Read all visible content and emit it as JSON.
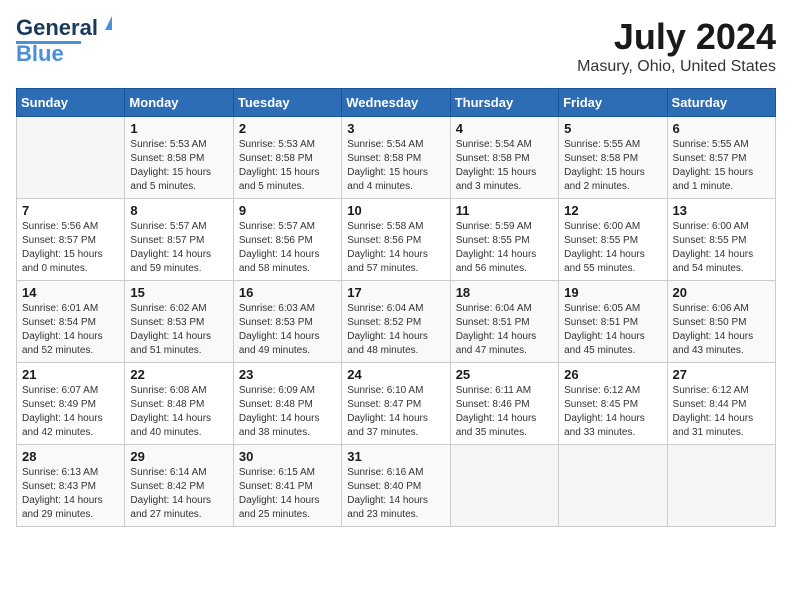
{
  "logo": {
    "text_general": "General",
    "text_blue": "Blue"
  },
  "header": {
    "month_year": "July 2024",
    "location": "Masury, Ohio, United States"
  },
  "weekdays": [
    "Sunday",
    "Monday",
    "Tuesday",
    "Wednesday",
    "Thursday",
    "Friday",
    "Saturday"
  ],
  "weeks": [
    [
      {
        "day": "",
        "sunrise": "",
        "sunset": "",
        "daylight": ""
      },
      {
        "day": "1",
        "sunrise": "Sunrise: 5:53 AM",
        "sunset": "Sunset: 8:58 PM",
        "daylight": "Daylight: 15 hours and 5 minutes."
      },
      {
        "day": "2",
        "sunrise": "Sunrise: 5:53 AM",
        "sunset": "Sunset: 8:58 PM",
        "daylight": "Daylight: 15 hours and 5 minutes."
      },
      {
        "day": "3",
        "sunrise": "Sunrise: 5:54 AM",
        "sunset": "Sunset: 8:58 PM",
        "daylight": "Daylight: 15 hours and 4 minutes."
      },
      {
        "day": "4",
        "sunrise": "Sunrise: 5:54 AM",
        "sunset": "Sunset: 8:58 PM",
        "daylight": "Daylight: 15 hours and 3 minutes."
      },
      {
        "day": "5",
        "sunrise": "Sunrise: 5:55 AM",
        "sunset": "Sunset: 8:58 PM",
        "daylight": "Daylight: 15 hours and 2 minutes."
      },
      {
        "day": "6",
        "sunrise": "Sunrise: 5:55 AM",
        "sunset": "Sunset: 8:57 PM",
        "daylight": "Daylight: 15 hours and 1 minute."
      }
    ],
    [
      {
        "day": "7",
        "sunrise": "Sunrise: 5:56 AM",
        "sunset": "Sunset: 8:57 PM",
        "daylight": "Daylight: 15 hours and 0 minutes."
      },
      {
        "day": "8",
        "sunrise": "Sunrise: 5:57 AM",
        "sunset": "Sunset: 8:57 PM",
        "daylight": "Daylight: 14 hours and 59 minutes."
      },
      {
        "day": "9",
        "sunrise": "Sunrise: 5:57 AM",
        "sunset": "Sunset: 8:56 PM",
        "daylight": "Daylight: 14 hours and 58 minutes."
      },
      {
        "day": "10",
        "sunrise": "Sunrise: 5:58 AM",
        "sunset": "Sunset: 8:56 PM",
        "daylight": "Daylight: 14 hours and 57 minutes."
      },
      {
        "day": "11",
        "sunrise": "Sunrise: 5:59 AM",
        "sunset": "Sunset: 8:55 PM",
        "daylight": "Daylight: 14 hours and 56 minutes."
      },
      {
        "day": "12",
        "sunrise": "Sunrise: 6:00 AM",
        "sunset": "Sunset: 8:55 PM",
        "daylight": "Daylight: 14 hours and 55 minutes."
      },
      {
        "day": "13",
        "sunrise": "Sunrise: 6:00 AM",
        "sunset": "Sunset: 8:55 PM",
        "daylight": "Daylight: 14 hours and 54 minutes."
      }
    ],
    [
      {
        "day": "14",
        "sunrise": "Sunrise: 6:01 AM",
        "sunset": "Sunset: 8:54 PM",
        "daylight": "Daylight: 14 hours and 52 minutes."
      },
      {
        "day": "15",
        "sunrise": "Sunrise: 6:02 AM",
        "sunset": "Sunset: 8:53 PM",
        "daylight": "Daylight: 14 hours and 51 minutes."
      },
      {
        "day": "16",
        "sunrise": "Sunrise: 6:03 AM",
        "sunset": "Sunset: 8:53 PM",
        "daylight": "Daylight: 14 hours and 49 minutes."
      },
      {
        "day": "17",
        "sunrise": "Sunrise: 6:04 AM",
        "sunset": "Sunset: 8:52 PM",
        "daylight": "Daylight: 14 hours and 48 minutes."
      },
      {
        "day": "18",
        "sunrise": "Sunrise: 6:04 AM",
        "sunset": "Sunset: 8:51 PM",
        "daylight": "Daylight: 14 hours and 47 minutes."
      },
      {
        "day": "19",
        "sunrise": "Sunrise: 6:05 AM",
        "sunset": "Sunset: 8:51 PM",
        "daylight": "Daylight: 14 hours and 45 minutes."
      },
      {
        "day": "20",
        "sunrise": "Sunrise: 6:06 AM",
        "sunset": "Sunset: 8:50 PM",
        "daylight": "Daylight: 14 hours and 43 minutes."
      }
    ],
    [
      {
        "day": "21",
        "sunrise": "Sunrise: 6:07 AM",
        "sunset": "Sunset: 8:49 PM",
        "daylight": "Daylight: 14 hours and 42 minutes."
      },
      {
        "day": "22",
        "sunrise": "Sunrise: 6:08 AM",
        "sunset": "Sunset: 8:48 PM",
        "daylight": "Daylight: 14 hours and 40 minutes."
      },
      {
        "day": "23",
        "sunrise": "Sunrise: 6:09 AM",
        "sunset": "Sunset: 8:48 PM",
        "daylight": "Daylight: 14 hours and 38 minutes."
      },
      {
        "day": "24",
        "sunrise": "Sunrise: 6:10 AM",
        "sunset": "Sunset: 8:47 PM",
        "daylight": "Daylight: 14 hours and 37 minutes."
      },
      {
        "day": "25",
        "sunrise": "Sunrise: 6:11 AM",
        "sunset": "Sunset: 8:46 PM",
        "daylight": "Daylight: 14 hours and 35 minutes."
      },
      {
        "day": "26",
        "sunrise": "Sunrise: 6:12 AM",
        "sunset": "Sunset: 8:45 PM",
        "daylight": "Daylight: 14 hours and 33 minutes."
      },
      {
        "day": "27",
        "sunrise": "Sunrise: 6:12 AM",
        "sunset": "Sunset: 8:44 PM",
        "daylight": "Daylight: 14 hours and 31 minutes."
      }
    ],
    [
      {
        "day": "28",
        "sunrise": "Sunrise: 6:13 AM",
        "sunset": "Sunset: 8:43 PM",
        "daylight": "Daylight: 14 hours and 29 minutes."
      },
      {
        "day": "29",
        "sunrise": "Sunrise: 6:14 AM",
        "sunset": "Sunset: 8:42 PM",
        "daylight": "Daylight: 14 hours and 27 minutes."
      },
      {
        "day": "30",
        "sunrise": "Sunrise: 6:15 AM",
        "sunset": "Sunset: 8:41 PM",
        "daylight": "Daylight: 14 hours and 25 minutes."
      },
      {
        "day": "31",
        "sunrise": "Sunrise: 6:16 AM",
        "sunset": "Sunset: 8:40 PM",
        "daylight": "Daylight: 14 hours and 23 minutes."
      },
      {
        "day": "",
        "sunrise": "",
        "sunset": "",
        "daylight": ""
      },
      {
        "day": "",
        "sunrise": "",
        "sunset": "",
        "daylight": ""
      },
      {
        "day": "",
        "sunrise": "",
        "sunset": "",
        "daylight": ""
      }
    ]
  ]
}
